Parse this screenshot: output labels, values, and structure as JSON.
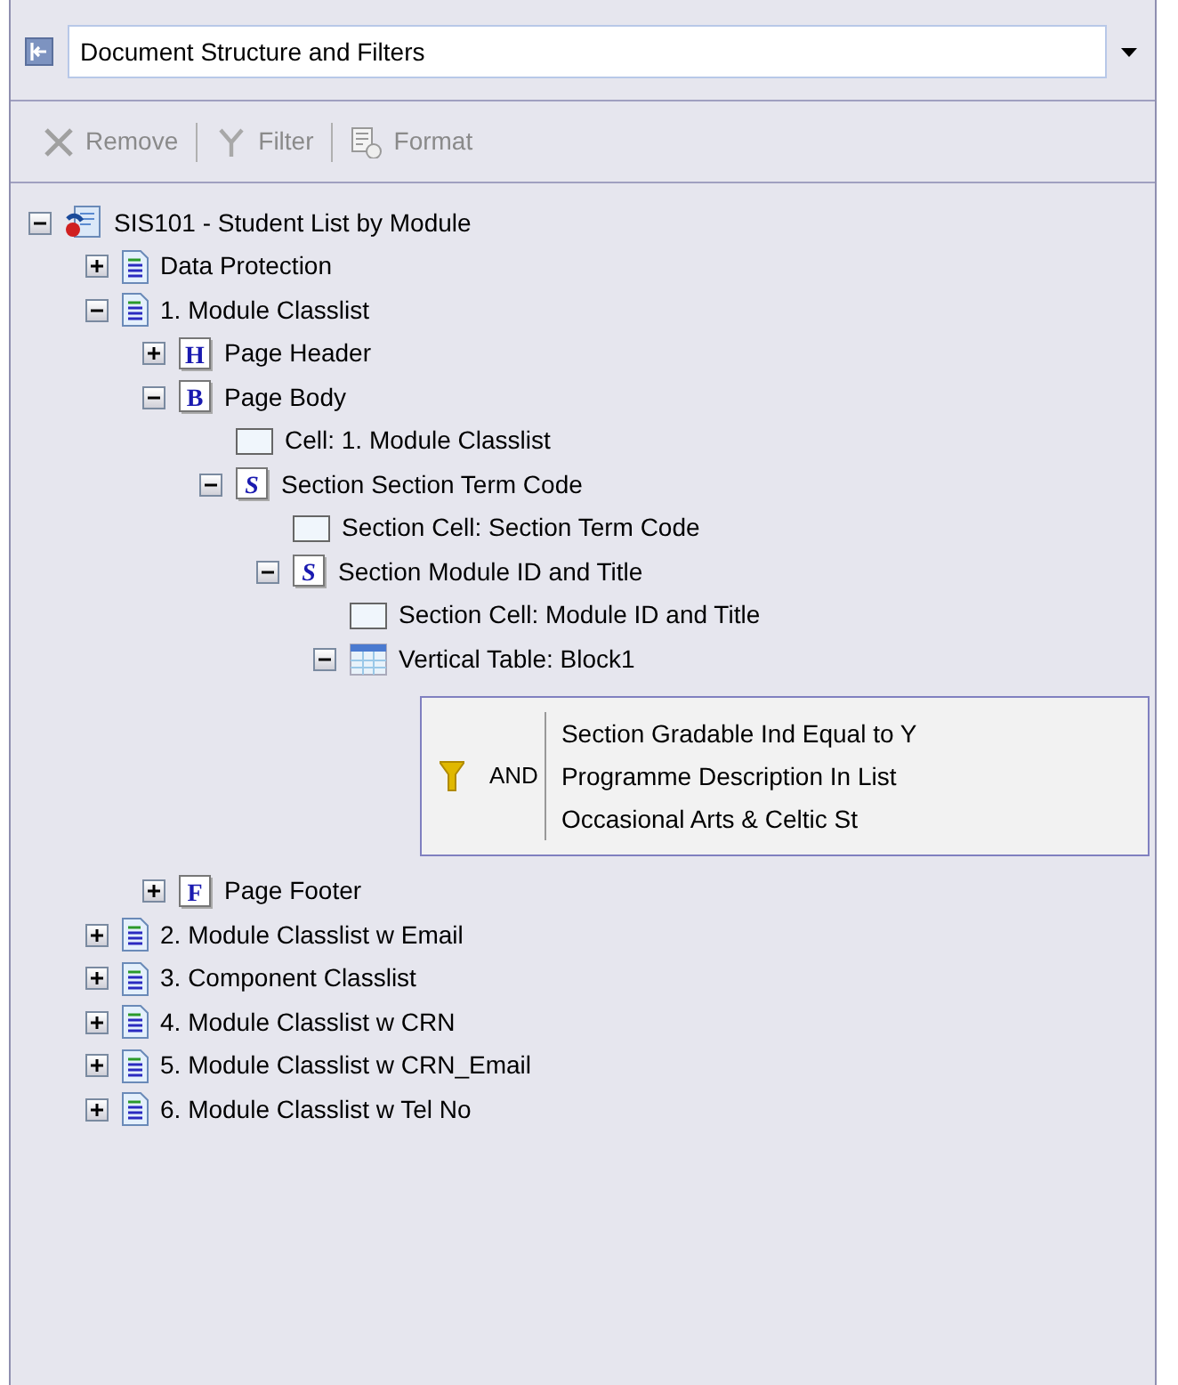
{
  "header": {
    "dropdown_value": "Document Structure and Filters"
  },
  "toolbar": [
    {
      "label": "Remove",
      "kind": "remove",
      "disabled": true
    },
    {
      "label": "Filter",
      "kind": "filter",
      "disabled": true
    },
    {
      "label": "Format",
      "kind": "format",
      "disabled": true
    }
  ],
  "tree": [
    {
      "label": "SIS101 - Student List by Module",
      "kind": "report",
      "expanded": true,
      "children": [
        {
          "label": "Data Protection",
          "kind": "document",
          "expanded": false
        },
        {
          "label": "1. Module Classlist",
          "kind": "document",
          "expanded": true,
          "children": [
            {
              "label": "Page Header",
              "kind": "band",
              "letter": "H",
              "expanded": false
            },
            {
              "label": "Page Body",
              "kind": "band",
              "letter": "B",
              "expanded": true,
              "children": [
                {
                  "label": "Cell: 1. Module Classlist",
                  "kind": "cell"
                },
                {
                  "label": "Section Section Term Code",
                  "kind": "section",
                  "letter": "S",
                  "expanded": true,
                  "children": [
                    {
                      "label": "Section Cell: Section Term Code",
                      "kind": "cell"
                    },
                    {
                      "label": "Section Module ID and Title",
                      "kind": "section",
                      "letter": "S",
                      "expanded": true,
                      "children": [
                        {
                          "label": "Section Cell: Module ID and Title",
                          "kind": "cell"
                        },
                        {
                          "label": "Vertical Table: Block1",
                          "kind": "table",
                          "expanded": true,
                          "children": [
                            {
                              "kind": "filter",
                              "operator": "AND",
                              "lines": [
                                "Section Gradable Ind Equal to Y",
                                "Programme Description In List",
                                "Occasional Arts & Celtic St"
                              ]
                            }
                          ]
                        }
                      ]
                    }
                  ]
                }
              ]
            },
            {
              "label": "Page Footer",
              "kind": "band",
              "letter": "F",
              "expanded": false
            }
          ]
        },
        {
          "label": "2. Module Classlist w Email",
          "kind": "document",
          "expanded": false
        },
        {
          "label": "3. Component Classlist",
          "kind": "document",
          "expanded": false
        },
        {
          "label": "4. Module Classlist w CRN",
          "kind": "document",
          "expanded": false
        },
        {
          "label": "5. Module Classlist w CRN_Email",
          "kind": "document",
          "expanded": false
        },
        {
          "label": "6. Module Classlist w Tel No",
          "kind": "document",
          "expanded": false
        }
      ]
    }
  ]
}
